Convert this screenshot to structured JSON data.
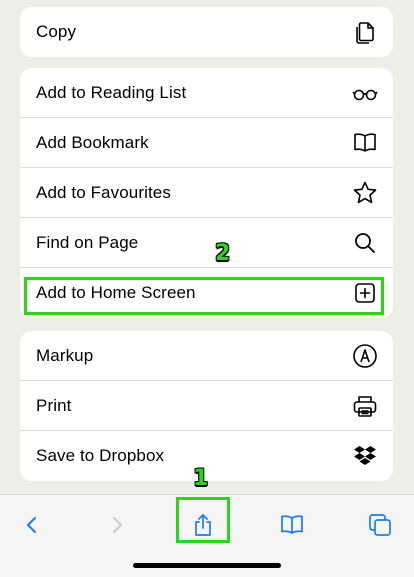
{
  "menu": {
    "group1": [
      {
        "label": "Copy",
        "icon": "copy-icon"
      }
    ],
    "group2": [
      {
        "label": "Add to Reading List",
        "icon": "glasses-icon"
      },
      {
        "label": "Add Bookmark",
        "icon": "book-icon"
      },
      {
        "label": "Add to Favourites",
        "icon": "star-icon"
      },
      {
        "label": "Find on Page",
        "icon": "search-icon"
      },
      {
        "label": "Add to Home Screen",
        "icon": "plus-square-icon"
      }
    ],
    "group3": [
      {
        "label": "Markup",
        "icon": "markup-icon"
      },
      {
        "label": "Print",
        "icon": "printer-icon"
      },
      {
        "label": "Save to Dropbox",
        "icon": "dropbox-icon"
      }
    ]
  },
  "annotations": {
    "step1": "1",
    "step2": "2",
    "highlight_color": "#2bd51b"
  },
  "toolbar": {
    "items": [
      "back-icon",
      "forward-icon",
      "share-icon",
      "bookmarks-icon",
      "tabs-icon"
    ],
    "accent_color": "#1a7cf4"
  }
}
